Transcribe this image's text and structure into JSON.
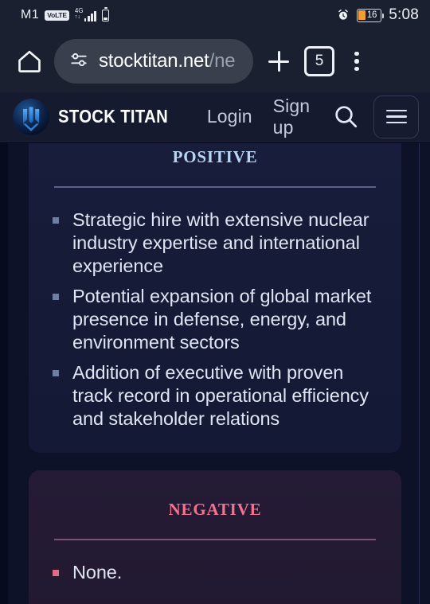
{
  "status_bar": {
    "carrier": "M1",
    "network_badge": "VoLTE",
    "network_type": "4G",
    "battery_percent": "16",
    "time": "5:08",
    "alarm_icon": "alarm-clock-icon",
    "signal_icon": "signal-bars-icon",
    "sim_battery_icon": "sim-battery-icon"
  },
  "browser": {
    "home_icon": "home-icon",
    "site_settings_icon": "site-settings-icon",
    "url_visible": "stocktitan.net",
    "url_dim": "/ne",
    "new_tab_icon": "plus-icon",
    "tab_count": "5",
    "overflow_icon": "three-dots-menu-icon"
  },
  "site_header": {
    "logo_icon": "stock-titan-logo-icon",
    "brand": "STOCK TITAN",
    "login_label": "Login",
    "signup_label": "Sign up",
    "search_icon": "search-icon",
    "menu_icon": "hamburger-menu-icon"
  },
  "main": {
    "positive": {
      "title": "Positive",
      "accent_color": "#b9d4f5",
      "bullets": [
        "Strategic hire with extensive nuclear industry expertise and international experience",
        "Potential expansion of global market presence in defense, energy, and environment sectors",
        "Addition of executive with proven track record in operational efficiency and stakeholder relations"
      ]
    },
    "negative": {
      "title": "Negative",
      "accent_color": "#f4728f",
      "bullets": [
        "None."
      ]
    }
  }
}
